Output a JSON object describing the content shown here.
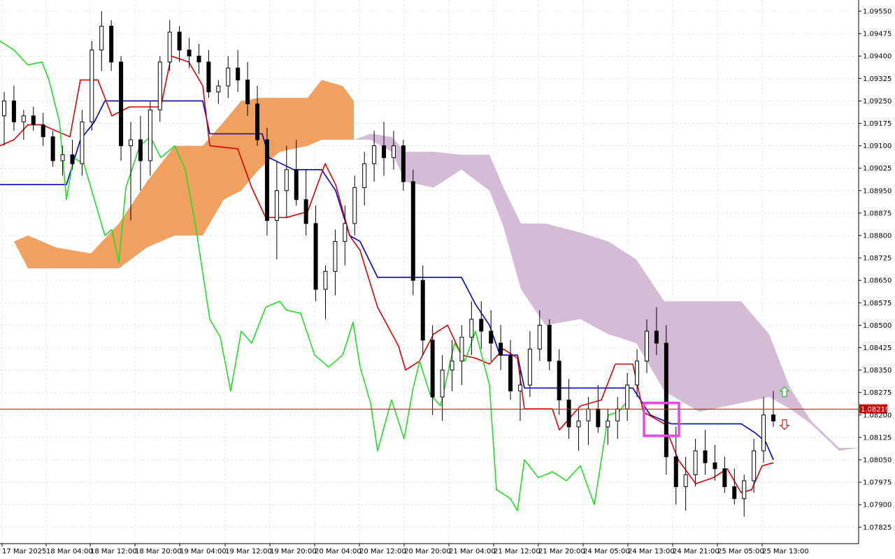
{
  "chart_data": {
    "type": "candlestick",
    "indicator": "Ichimoku Kinko Hyo",
    "y_range": [
      1.0775,
      1.0962
    ],
    "y_ticks": [
      "1.09550",
      "1.09475",
      "1.09400",
      "1.09325",
      "1.09250",
      "1.09175",
      "1.09100",
      "1.09025",
      "1.08950",
      "1.08875",
      "1.08800",
      "1.08725",
      "1.08650",
      "1.08575",
      "1.08500",
      "1.08425",
      "1.08350",
      "1.08275",
      "1.08200",
      "1.08125",
      "1.08050",
      "1.07975",
      "1.07900",
      "1.07825"
    ],
    "x_ticks": [
      "17 Mar 2025",
      "18 Mar 04:00",
      "18 Mar 12:00",
      "18 Mar 20:00",
      "19 Mar 04:00",
      "19 Mar 12:00",
      "19 Mar 20:00",
      "20 Mar 04:00",
      "20 Mar 12:00",
      "20 Mar 20:00",
      "21 Mar 04:00",
      "21 Mar 12:00",
      "21 Mar 20:00",
      "24 Mar 05:00",
      "24 Mar 13:00",
      "24 Mar 21:00",
      "25 Mar 05:00",
      "25 Mar 13:00"
    ],
    "current_price": "1.08219",
    "colors": {
      "background": "#ffffff",
      "grid": "#e8e8e8",
      "bull_candle": "#ffffff",
      "bear_candle": "#000000",
      "tenkan": "#dd0000",
      "kijun": "#0000cc",
      "chikou": "#22dd22",
      "kumo_bull": "#f0a060",
      "kumo_bear": "#d4bcd6",
      "price_line": "#cc0000",
      "highlight_box": "#ee44ee",
      "arrow_up": "#44bb44",
      "arrow_down": "#dd3333"
    },
    "candles": [
      [
        1.092,
        1.0928,
        1.091,
        1.0925
      ],
      [
        1.0925,
        1.093,
        1.0915,
        1.0918
      ],
      [
        1.0918,
        1.0922,
        1.0912,
        1.092
      ],
      [
        1.092,
        1.0923,
        1.0915,
        1.0917
      ],
      [
        1.0917,
        1.0921,
        1.091,
        1.0913
      ],
      [
        1.0913,
        1.0915,
        1.0903,
        1.0905
      ],
      [
        1.0905,
        1.091,
        1.09,
        1.0907
      ],
      [
        1.0907,
        1.0912,
        1.0902,
        1.0904
      ],
      [
        1.0904,
        1.0922,
        1.09,
        1.0918
      ],
      [
        1.0918,
        1.0945,
        1.0915,
        1.0942
      ],
      [
        1.0942,
        1.0955,
        1.0935,
        1.095
      ],
      [
        1.095,
        1.0952,
        1.0935,
        1.0938
      ],
      [
        1.0938,
        1.094,
        1.0905,
        1.091
      ],
      [
        1.091,
        1.0918,
        1.0885,
        1.0912
      ],
      [
        1.0912,
        1.092,
        1.0895,
        1.0905
      ],
      [
        1.0905,
        1.0925,
        1.09,
        1.0922
      ],
      [
        1.0922,
        1.094,
        1.0918,
        1.0938
      ],
      [
        1.0938,
        1.0952,
        1.0935,
        1.0948
      ],
      [
        1.0948,
        1.095,
        1.0938,
        1.0942
      ],
      [
        1.0942,
        1.0946,
        1.0936,
        1.094
      ],
      [
        1.094,
        1.0944,
        1.0934,
        1.0938
      ],
      [
        1.0938,
        1.0942,
        1.0926,
        1.0928
      ],
      [
        1.0928,
        1.0932,
        1.0924,
        1.093
      ],
      [
        1.093,
        1.094,
        1.0926,
        1.0936
      ],
      [
        1.0936,
        1.0942,
        1.0928,
        1.0932
      ],
      [
        1.0932,
        1.0938,
        1.092,
        1.0924
      ],
      [
        1.0924,
        1.093,
        1.091,
        1.0912
      ],
      [
        1.0912,
        1.0916,
        1.088,
        1.0885
      ],
      [
        1.0885,
        1.0905,
        1.0872,
        1.0895
      ],
      [
        1.0895,
        1.091,
        1.0886,
        1.0902
      ],
      [
        1.0902,
        1.0912,
        1.089,
        1.0892
      ],
      [
        1.0892,
        1.0902,
        1.088,
        1.0884
      ],
      [
        1.0884,
        1.089,
        1.0858,
        1.0862
      ],
      [
        1.0862,
        1.087,
        1.0852,
        1.0868
      ],
      [
        1.0868,
        1.0882,
        1.086,
        1.0878
      ],
      [
        1.0878,
        1.089,
        1.087,
        1.0884
      ],
      [
        1.0884,
        1.09,
        1.088,
        1.0896
      ],
      [
        1.0896,
        1.0908,
        1.089,
        1.0904
      ],
      [
        1.0904,
        1.0915,
        1.0898,
        1.091
      ],
      [
        1.091,
        1.0918,
        1.09,
        1.0906
      ],
      [
        1.0906,
        1.0915,
        1.0902,
        1.091
      ],
      [
        1.091,
        1.0912,
        1.0895,
        1.0898
      ],
      [
        1.0898,
        1.0902,
        1.086,
        1.0865
      ],
      [
        1.0865,
        1.087,
        1.084,
        1.0845
      ],
      [
        1.0845,
        1.085,
        1.082,
        1.0826
      ],
      [
        1.0826,
        1.084,
        1.0818,
        1.0835
      ],
      [
        1.0835,
        1.0845,
        1.0828,
        1.0838
      ],
      [
        1.0838,
        1.085,
        1.083,
        1.0846
      ],
      [
        1.0846,
        1.0858,
        1.084,
        1.0852
      ],
      [
        1.0852,
        1.0858,
        1.0842,
        1.0848
      ],
      [
        1.0848,
        1.0855,
        1.0838,
        1.0844
      ],
      [
        1.0844,
        1.085,
        1.0835,
        1.084
      ],
      [
        1.084,
        1.0845,
        1.0825,
        1.0828
      ],
      [
        1.0828,
        1.0835,
        1.0818,
        1.083
      ],
      [
        1.083,
        1.0848,
        1.0826,
        1.0842
      ],
      [
        1.0842,
        1.0855,
        1.0838,
        1.085
      ],
      [
        1.085,
        1.0852,
        1.0835,
        1.0838
      ],
      [
        1.0838,
        1.0842,
        1.082,
        1.0825
      ],
      [
        1.0825,
        1.0832,
        1.0812,
        1.0816
      ],
      [
        1.0816,
        1.0822,
        1.0808,
        1.0818
      ],
      [
        1.0818,
        1.0826,
        1.081,
        1.0822
      ],
      [
        1.0822,
        1.083,
        1.0814,
        1.0816
      ],
      [
        1.0816,
        1.0822,
        1.081,
        1.0818
      ],
      [
        1.0818,
        1.0826,
        1.0812,
        1.0822
      ],
      [
        1.0822,
        1.0834,
        1.0818,
        1.083
      ],
      [
        1.083,
        1.0842,
        1.0826,
        1.0838
      ],
      [
        1.0838,
        1.0852,
        1.0834,
        1.0848
      ],
      [
        1.0848,
        1.0856,
        1.084,
        1.0844
      ],
      [
        1.0844,
        1.085,
        1.08,
        1.0806
      ],
      [
        1.0806,
        1.0816,
        1.079,
        1.0796
      ],
      [
        1.0796,
        1.0806,
        1.0788,
        1.08
      ],
      [
        1.08,
        1.0812,
        1.0796,
        1.0808
      ],
      [
        1.0808,
        1.0815,
        1.08,
        1.0804
      ],
      [
        1.0804,
        1.081,
        1.0798,
        1.0802
      ],
      [
        1.0802,
        1.0806,
        1.0794,
        1.0796
      ],
      [
        1.0796,
        1.0802,
        1.079,
        1.0792
      ],
      [
        1.0792,
        1.08,
        1.0786,
        1.0798
      ],
      [
        1.0798,
        1.0812,
        1.0794,
        1.0808
      ],
      [
        1.0808,
        1.0826,
        1.0804,
        1.082
      ],
      [
        1.082,
        1.0828,
        1.0816,
        1.0818
      ]
    ]
  }
}
